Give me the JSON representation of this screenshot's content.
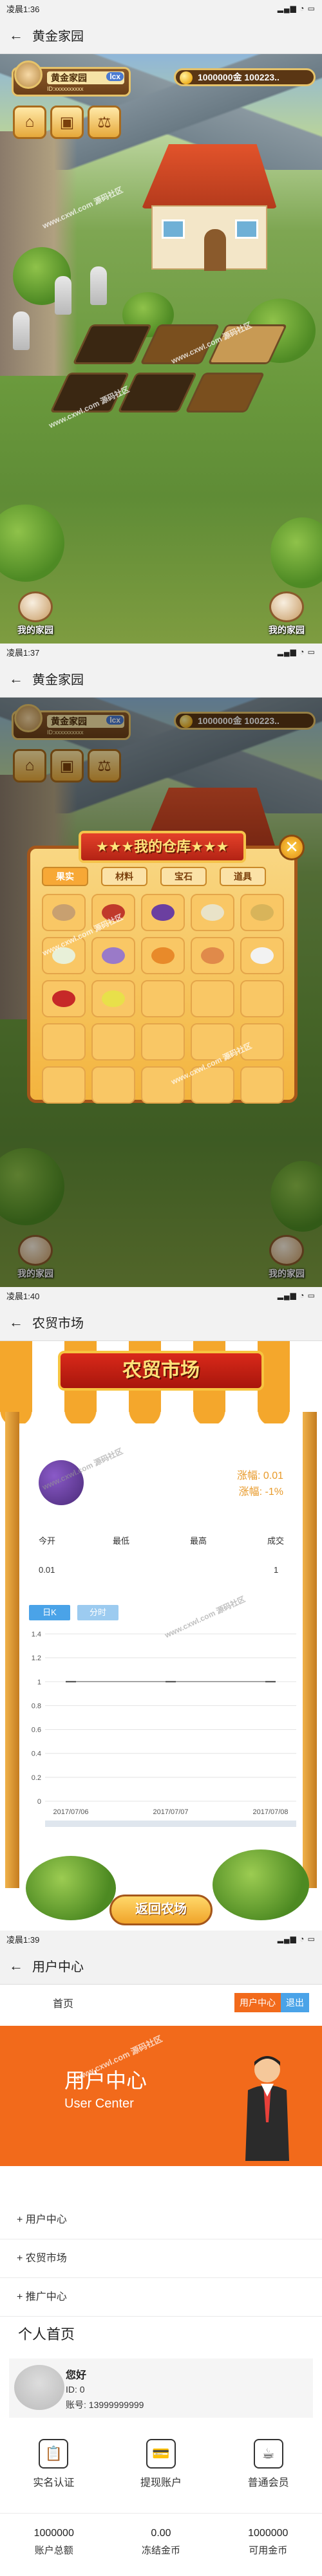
{
  "screen1": {
    "status": {
      "time": "凌晨1:36",
      "signal": "▂▄▆ ◔ ▭"
    },
    "title": "黄金家园",
    "hud": {
      "name": "黄金家园",
      "sub": "ID:xxxxxxxxxx",
      "level": "lcx",
      "coins": "1000000金  100223.."
    },
    "watermark": "www.cxwl.com  源码社区",
    "btn_left": "我的家园",
    "btn_right": "我的家园"
  },
  "screen2": {
    "status": {
      "time": "凌晨1:37",
      "signal": "▂▄▆ ◔ ▭"
    },
    "title": "黄金家园",
    "hud": {
      "name": "黄金家园",
      "sub": "ID:xxxxxxxxxx",
      "level": "lcx",
      "coins": "1000000金  100223.."
    },
    "warehouse": {
      "title": "★★★我的仓库★★★",
      "close": "✕",
      "tabs": [
        "果实",
        "材料",
        "宝石",
        "道具"
      ]
    },
    "watermark": "www.cxwl.com  源码社区",
    "btn_left": "我的家园",
    "btn_right": "我的家园"
  },
  "screen3": {
    "status": {
      "time": "凌晨1:40",
      "signal": "▂▄▆ ◔ ▭"
    },
    "title": "农贸市场",
    "market_title": "农贸市场",
    "change": "涨幅: 0.01",
    "change_pct": "涨幅: -1%",
    "columns": [
      "今开",
      "最低",
      "最高",
      "成交"
    ],
    "values": [
      "0.01",
      "",
      "",
      "1"
    ],
    "tab_k": "日K",
    "tab_m": "分时",
    "return_btn": "返回农场",
    "watermark": "www.cxwl.com  源码社区"
  },
  "chart_data": {
    "type": "line",
    "x": [
      "2017/07/06",
      "2017/07/07",
      "2017/07/08"
    ],
    "series": [
      {
        "values": [
          1,
          1,
          1
        ]
      }
    ],
    "ylim": [
      0,
      1.4
    ],
    "yticks": [
      "1.4",
      "1.2",
      "1",
      "0.8",
      "0.6",
      "0.4",
      "0.2",
      "0"
    ],
    "grid": true
  },
  "screen4": {
    "status": {
      "time": "凌晨1:39",
      "signal": "▂▄▆ ◔ ▭"
    },
    "title": "用户中心",
    "home": "首页",
    "head_btn": "用户中心",
    "logout": "退出",
    "banner_cn": "用户中心",
    "banner_en": "User Center",
    "menu": [
      "+ 用户中心",
      "+ 农贸市场",
      "+ 推广中心"
    ],
    "section": "个人首页",
    "profile": {
      "name": "您好",
      "id": "ID: 0",
      "account": "账号: 13999999999"
    },
    "actions": [
      {
        "icon": "📋",
        "label": "实名认证"
      },
      {
        "icon": "💳",
        "label": "提现账户"
      },
      {
        "icon": "☕",
        "label": "普通会员"
      }
    ],
    "stats": [
      {
        "value": "1000000",
        "label": "账户总额"
      },
      {
        "value": "0.00",
        "label": "冻结金币"
      },
      {
        "value": "1000000",
        "label": "可用金币"
      }
    ],
    "watermark": "www.cxwl.com  源码社区"
  },
  "colors": {
    "orange": "#f26a1b",
    "blue": "#4aa3e8",
    "red": "#d9291a"
  }
}
